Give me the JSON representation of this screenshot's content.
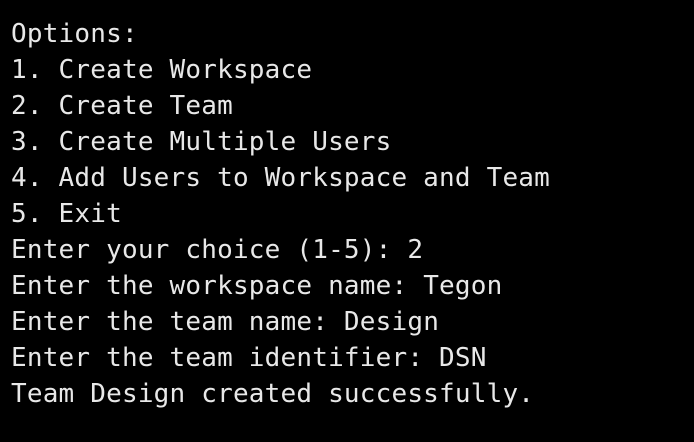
{
  "terminal": {
    "header": "Options:",
    "menu": [
      "1. Create Workspace",
      "2. Create Team",
      "3. Create Multiple Users",
      "4. Add Users to Workspace and Team",
      "5. Exit"
    ],
    "prompts": [
      {
        "label": "Enter your choice (1-5): ",
        "value": "2"
      },
      {
        "label": "Enter the workspace name: ",
        "value": "Tegon"
      },
      {
        "label": "Enter the team name: ",
        "value": "Design"
      },
      {
        "label": "Enter the team identifier: ",
        "value": "DSN"
      }
    ],
    "result": "Team Design created successfully.",
    "colors": {
      "background": "#000000",
      "text": "#e8e8e8"
    }
  }
}
